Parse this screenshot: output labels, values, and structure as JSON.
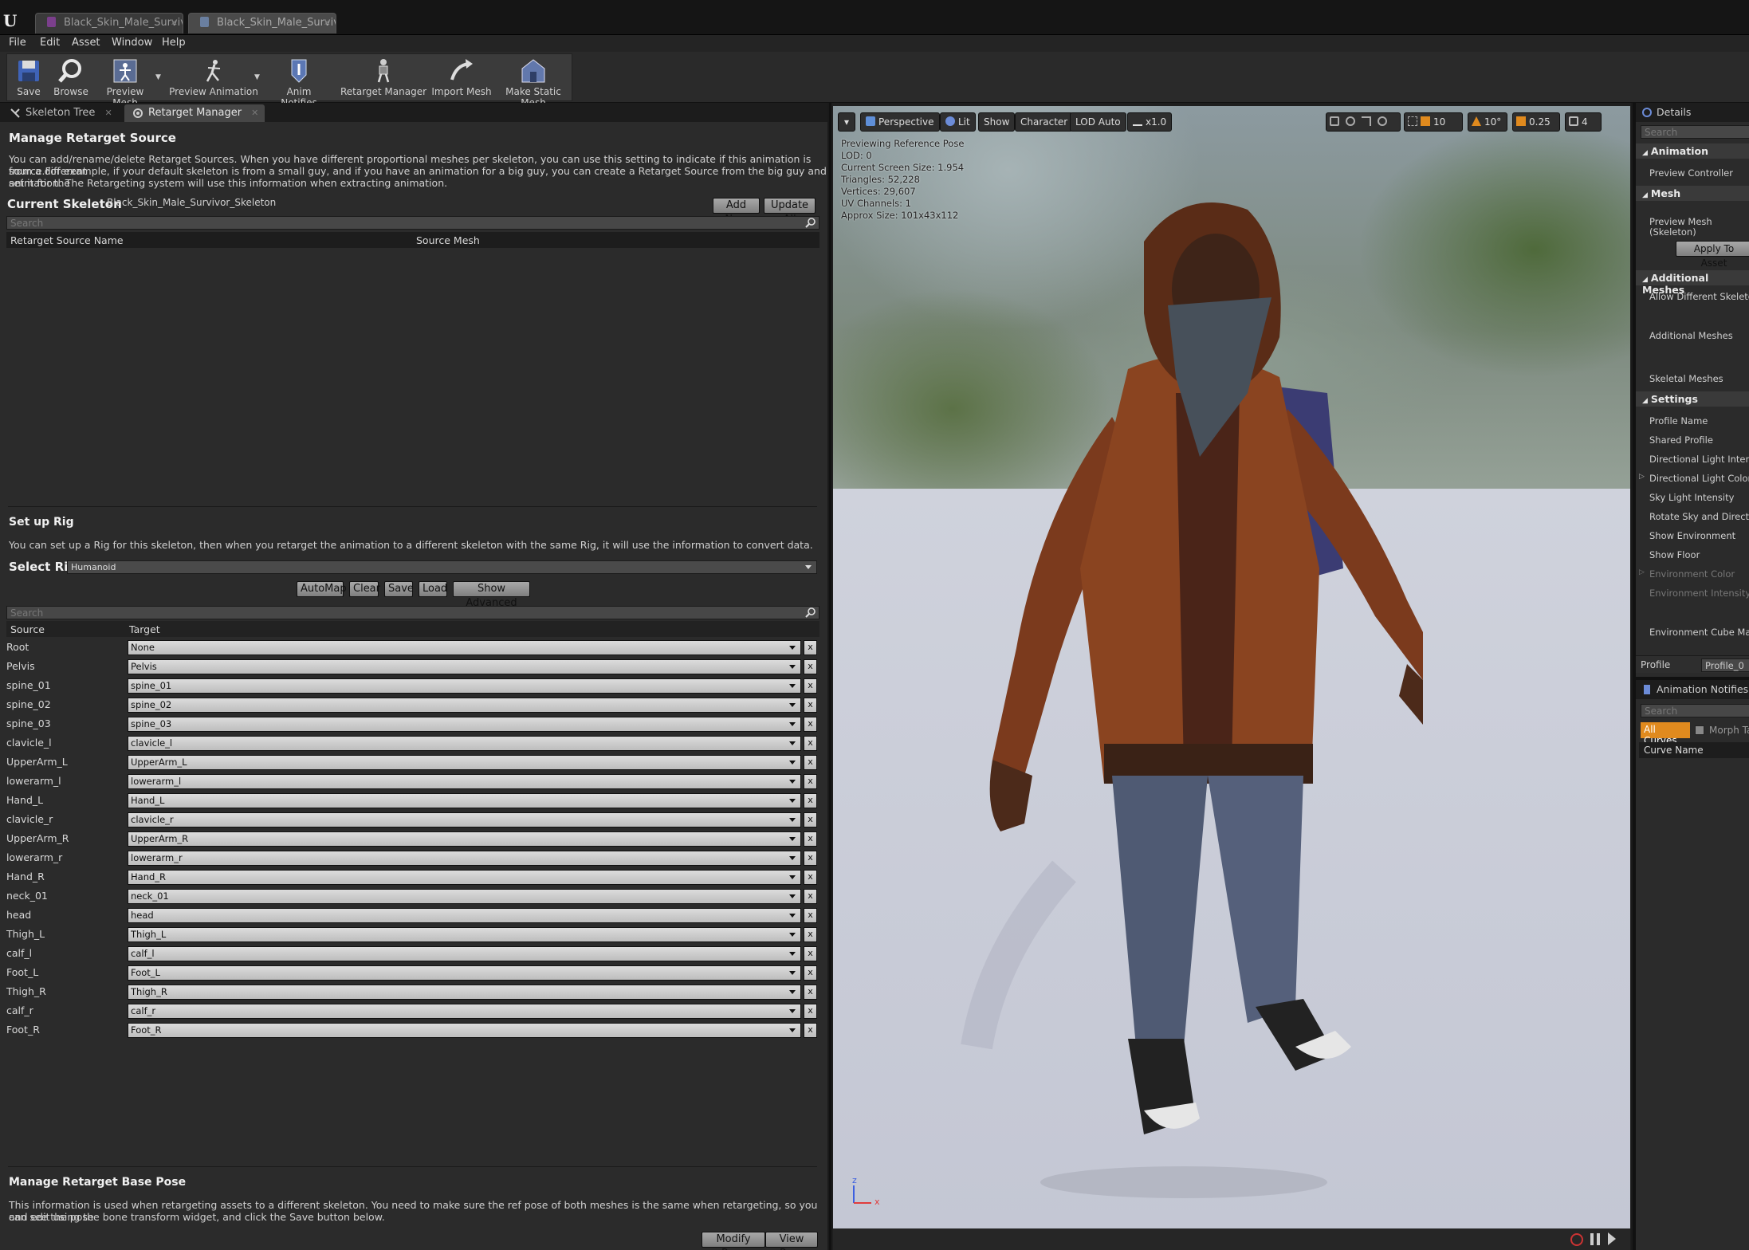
{
  "doc_tabs": [
    {
      "label": "Black_Skin_Male_Survivor",
      "active": false
    },
    {
      "label": "Black_Skin_Male_Survivor",
      "active": true
    }
  ],
  "menu": [
    "File",
    "Edit",
    "Asset",
    "Window",
    "Help"
  ],
  "toolbar": {
    "save": "Save",
    "browse": "Browse",
    "preview_mesh": "Preview Mesh",
    "preview_animation": "Preview Animation",
    "anim_notifies": "Anim Notifies",
    "retarget_manager": "Retarget Manager",
    "import_mesh": "Import Mesh",
    "make_static_mesh": "Make Static Mesh"
  },
  "left_tabs": {
    "skeleton_tree": "Skeleton Tree",
    "retarget_manager": "Retarget Manager"
  },
  "retarget_source": {
    "title": "Manage Retarget Source",
    "desc1": "You can add/rename/delete Retarget Sources. When you have different proportional meshes per skeleton, you can use this setting to indicate if this animation is from a different",
    "desc2": "source.For example, if your default skeleton is from a small guy, and if you have an animation for a big guy, you can create a Retarget Source from the big guy and set it for the",
    "desc3": "animation. The Retargeting system will use this information when extracting animation.",
    "current_skeleton_label": "Current Skeleton",
    "current_skeleton_value": "Black_Skin_Male_Survivor_Skeleton",
    "add_new": "Add New",
    "update_all": "Update All",
    "search_placeholder": "Search",
    "col_name": "Retarget Source Name",
    "col_mesh": "Source Mesh"
  },
  "rig": {
    "title": "Set up Rig",
    "desc": "You can set up a Rig for this skeleton, then when you retarget the animation to a different skeleton with the same Rig, it will use the information to convert data.",
    "select_rig_label": "Select Rig",
    "select_rig_value": "Humanoid",
    "automap": "AutoMap",
    "clear": "Clear",
    "save": "Save",
    "load": "Load",
    "show_advanced": "Show Advanced",
    "search_placeholder": "Search",
    "col_source": "Source",
    "col_target": "Target",
    "rows": [
      {
        "source": "Root",
        "target": "None"
      },
      {
        "source": "Pelvis",
        "target": "Pelvis"
      },
      {
        "source": "spine_01",
        "target": "spine_01"
      },
      {
        "source": "spine_02",
        "target": "spine_02"
      },
      {
        "source": "spine_03",
        "target": "spine_03"
      },
      {
        "source": "clavicle_l",
        "target": "clavicle_l"
      },
      {
        "source": "UpperArm_L",
        "target": "UpperArm_L"
      },
      {
        "source": "lowerarm_l",
        "target": "lowerarm_l"
      },
      {
        "source": "Hand_L",
        "target": "Hand_L"
      },
      {
        "source": "clavicle_r",
        "target": "clavicle_r"
      },
      {
        "source": "UpperArm_R",
        "target": "UpperArm_R"
      },
      {
        "source": "lowerarm_r",
        "target": "lowerarm_r"
      },
      {
        "source": "Hand_R",
        "target": "Hand_R"
      },
      {
        "source": "neck_01",
        "target": "neck_01"
      },
      {
        "source": "head",
        "target": "head"
      },
      {
        "source": "Thigh_L",
        "target": "Thigh_L"
      },
      {
        "source": "calf_l",
        "target": "calf_l"
      },
      {
        "source": "Foot_L",
        "target": "Foot_L"
      },
      {
        "source": "Thigh_R",
        "target": "Thigh_R"
      },
      {
        "source": "calf_r",
        "target": "calf_r"
      },
      {
        "source": "Foot_R",
        "target": "Foot_R"
      }
    ],
    "remove_glyph": "x"
  },
  "base_pose": {
    "title": "Manage Retarget Base Pose",
    "desc1": "This information is used when retargeting assets to a different skeleton. You need to make sure the ref pose of both meshes is the same when retargeting, so you can see the pose",
    "desc2": "and edit using the bone transform widget, and click the Save button below.",
    "modify_pose": "Modify Pose",
    "view_pose": "View Pose"
  },
  "viewport": {
    "menu_glyph": "▾",
    "perspective": "Perspective",
    "lit": "Lit",
    "show": "Show",
    "character": "Character",
    "lod": "LOD Auto",
    "speed": "x1.0",
    "grid_snap": "10",
    "rot_snap": "10°",
    "scale_snap": "0.25",
    "cam_speed": "4",
    "info": [
      "Previewing Reference Pose",
      "LOD: 0",
      "Current Screen Size: 1.954",
      "Triangles: 52,228",
      "Vertices: 29,607",
      "UV Channels: 1",
      "Approx Size: 101x43x112"
    ],
    "axis_z": "z",
    "axis_x": "x"
  },
  "details": {
    "tab": "Details",
    "search_placeholder": "Search",
    "animation_cat": "Animation",
    "preview_controller": "Preview Controller",
    "mesh_cat": "Mesh",
    "preview_mesh_1": "Preview Mesh",
    "preview_mesh_2": "(Skeleton)",
    "apply_to_asset": "Apply To Asset",
    "additional_cat": "Additional Meshes",
    "allow_different": "Allow Different Skeletons",
    "additional_meshes": "Additional Meshes",
    "skeletal_meshes": "Skeletal Meshes",
    "settings_cat": "Settings",
    "profile_name": "Profile Name",
    "shared_profile": "Shared Profile",
    "dir_light_intensity": "Directional Light Intensity",
    "dir_light_color": "Directional Light Color",
    "sky_light_intensity": "Sky Light Intensity",
    "rotate_sky": "Rotate Sky and Directional",
    "show_env": "Show Environment",
    "show_floor": "Show Floor",
    "env_color": "Environment Color",
    "env_intensity": "Environment Intensity",
    "env_cube_map": "Environment Cube Map",
    "profile_label": "Profile",
    "profile_value": "Profile_0"
  },
  "anim_notifies_panel": {
    "tab": "Animation Notifies",
    "search_placeholder": "Search",
    "all_curves": "All Curves",
    "morph_target": "Morph Ta",
    "curve_name": "Curve Name"
  },
  "colors": {
    "accent_orange": "#e08a1e",
    "panel_bg": "#2b2b2b"
  }
}
